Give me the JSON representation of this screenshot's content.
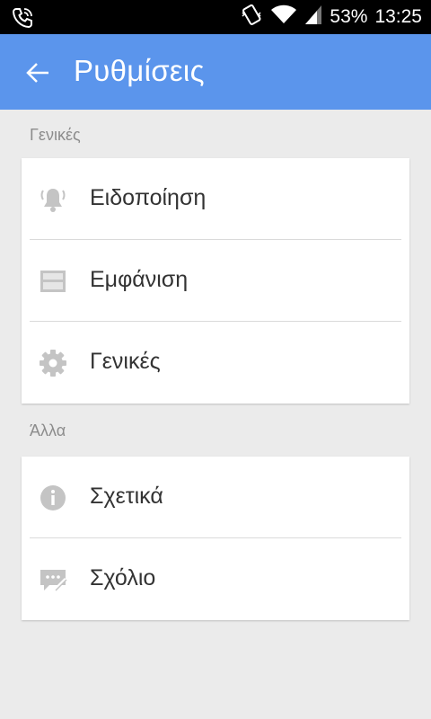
{
  "status_bar": {
    "battery": "53%",
    "time": "13:25",
    "icons": [
      "phone-call-icon",
      "vibrate-icon",
      "wifi-icon",
      "signal-icon"
    ]
  },
  "app_bar": {
    "title": "Ρυθμίσεις",
    "back_icon": "back-arrow-icon",
    "color": "#5b95ec"
  },
  "sections": [
    {
      "header": "Γενικές",
      "items": [
        {
          "label": "Ειδοποίηση",
          "icon": "bell-icon"
        },
        {
          "label": "Εμφάνιση",
          "icon": "display-icon"
        },
        {
          "label": "Γενικές",
          "icon": "gear-icon"
        }
      ]
    },
    {
      "header": "Άλλα",
      "items": [
        {
          "label": "Σχετικά",
          "icon": "info-icon"
        },
        {
          "label": "Σχόλιο",
          "icon": "feedback-icon"
        }
      ]
    }
  ]
}
